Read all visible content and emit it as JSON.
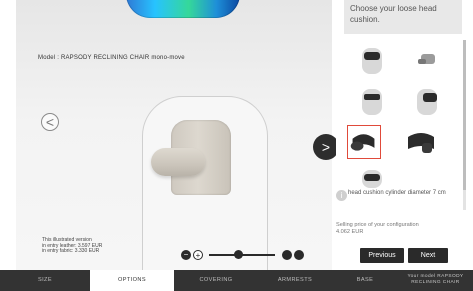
{
  "viewer": {
    "model_title": "Model : RAPSODY RECLINING CHAIR mono-move",
    "nav_prev_glyph": "<",
    "nav_next_glyph": ">",
    "price_lines": [
      "This illustrated version",
      "in entry leather:   3.597 EUR",
      "in entry fabric:    3.330 EUR"
    ],
    "zoom": {
      "minus_glyph": "−",
      "plus_glyph": "+",
      "level_fraction": 0.45
    }
  },
  "panel": {
    "title": "Choose your loose head cushion.",
    "options": [
      {
        "label": "",
        "selected": false
      },
      {
        "label": "",
        "selected": false
      },
      {
        "label": "",
        "selected": false
      },
      {
        "label": "",
        "selected": false
      },
      {
        "label": "",
        "selected": true
      },
      {
        "label": "",
        "selected": false
      },
      {
        "label": "",
        "selected": false
      }
    ],
    "info_icon_glyph": "i",
    "selected_description": "head cushion  cylinder diameter 7 cm",
    "selling_price_label": "Selling price of your configuration",
    "selling_price_value": "4.062 EUR",
    "previous_label": "Previous",
    "next_label": "Next"
  },
  "tabs": {
    "items": [
      "SIZE",
      "OPTIONS",
      "COVERING",
      "ARMRESTS",
      "BASE"
    ],
    "active_index": 1,
    "summary_label": "Your model RAPSODY RECLINING CHAIR"
  },
  "colors": {
    "accent_selected": "#e04a3a",
    "dark": "#2a2a2a",
    "tabbar": "#333333"
  }
}
